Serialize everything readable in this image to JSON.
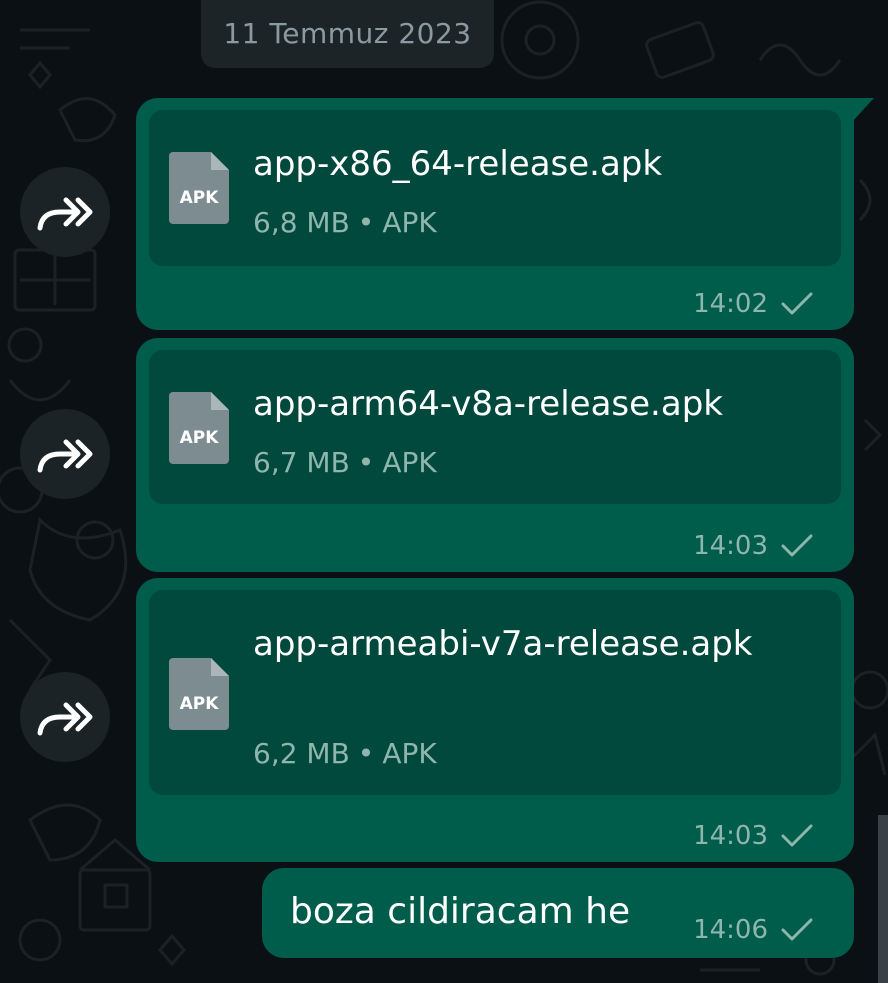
{
  "date_chip": "11 Temmuz 2023",
  "colors": {
    "background": "#0b1014",
    "outgoing_bubble": "#005c4b",
    "document_card": "#02493d",
    "meta_text": "#8fb6ad",
    "date_chip": "#1d2428"
  },
  "icons": {
    "forward": "forward-icon",
    "document": "apk-file-icon",
    "status": "sent-check-icon"
  },
  "messages": [
    {
      "type": "document",
      "file_name": "app-x86_64-release.apk",
      "file_icon_label": "APK",
      "file_size": "6,8 MB",
      "file_type": "APK",
      "time": "14:02"
    },
    {
      "type": "document",
      "file_name": "app-arm64-v8a-release.apk",
      "file_icon_label": "APK",
      "file_size": "6,7 MB",
      "file_type": "APK",
      "time": "14:03"
    },
    {
      "type": "document",
      "file_name": "app-armeabi-v7a-release.apk",
      "file_icon_label": "APK",
      "file_size": "6,2 MB",
      "file_type": "APK",
      "time": "14:03"
    },
    {
      "type": "text",
      "text": "boza cildiracam he",
      "time": "14:06"
    }
  ]
}
